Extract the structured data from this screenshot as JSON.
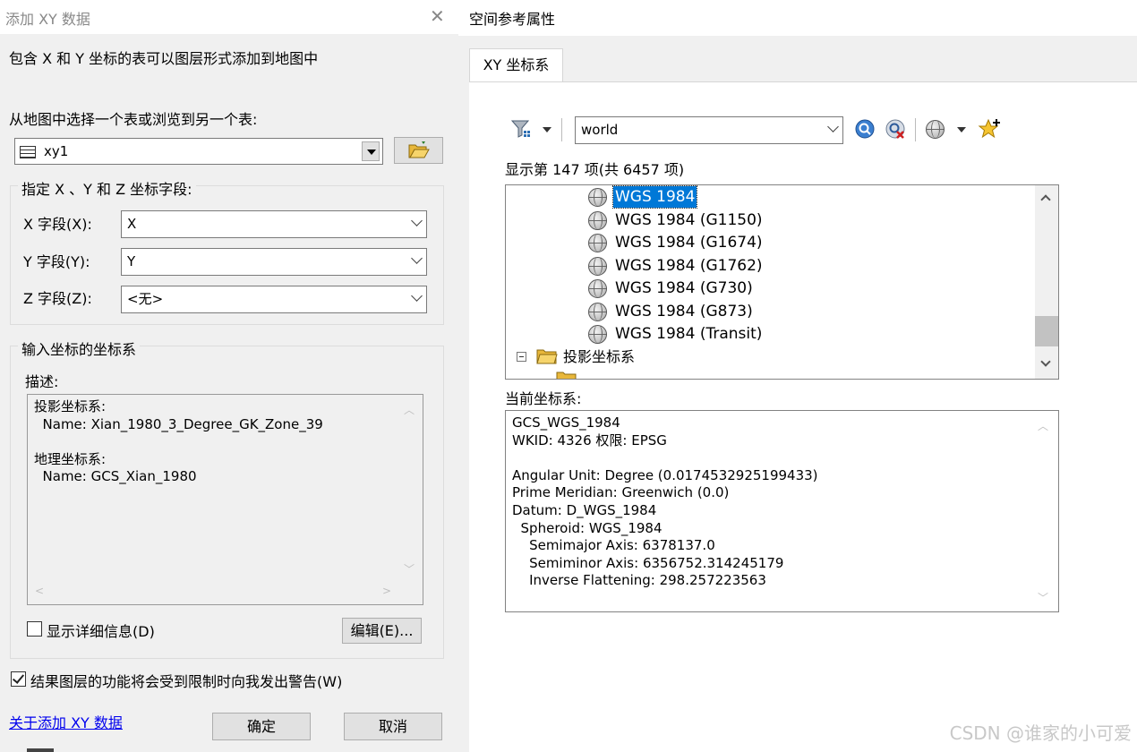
{
  "left_dialog": {
    "title": "添加 XY 数据",
    "close_glyph": "✕",
    "intro": "包含 X 和 Y 坐标的表可以图层形式添加到地图中",
    "choose_table_label": "从地图中选择一个表或浏览到另一个表:",
    "table_value": "xy1",
    "fields_group_title": "指定 X 、Y 和 Z 坐标字段:",
    "x_label": "X 字段(X):",
    "x_value": "X",
    "y_label": "Y 字段(Y):",
    "y_value": "Y",
    "z_label": "Z 字段(Z):",
    "z_value": "<无>",
    "coord_group_title": "输入坐标的坐标系",
    "desc_label": "描述:",
    "desc_lines": [
      "投影坐标系:",
      "  Name: Xian_1980_3_Degree_GK_Zone_39",
      "",
      "地理坐标系:",
      "  Name: GCS_Xian_1980"
    ],
    "show_details_label": "显示详细信息(D)",
    "show_details_checked": false,
    "edit_button": "编辑(E)...",
    "warn_label": "结果图层的功能将会受到限制时向我发出警告(W)",
    "warn_checked": true,
    "about_link": "关于添加 XY 数据",
    "ok_button": "确定",
    "cancel_button": "取消"
  },
  "right_window": {
    "title": "空间参考属性",
    "tab_label": "XY 坐标系",
    "search_value": "world",
    "count_text": "显示第 147 项(共 6457 项)",
    "list_items": [
      "WGS 1984",
      "WGS 1984 (G1150)",
      "WGS 1984 (G1674)",
      "WGS 1984 (G1762)",
      "WGS 1984 (G730)",
      "WGS 1984 (G873)",
      "WGS 1984 (Transit)"
    ],
    "selected_item": "WGS 1984",
    "folder_item": "投影坐标系",
    "current_label": "当前坐标系:",
    "current_lines": [
      "GCS_WGS_1984",
      "WKID: 4326 权限: EPSG",
      "",
      "Angular Unit: Degree (0.0174532925199433)",
      "Prime Meridian: Greenwich (0.0)",
      "Datum: D_WGS_1984",
      "  Spheroid: WGS_1984",
      "    Semimajor Axis: 6378137.0",
      "    Semiminor Axis: 6356752.314245179",
      "    Inverse Flattening: 298.257223563"
    ]
  },
  "watermark": "CSDN @谁家的小可爱",
  "colors": {
    "selection_bg": "#cce8ff",
    "selection_text_bg": "#0078d7",
    "dialog_bg": "#f0f0f0",
    "link": "#0000ee"
  }
}
